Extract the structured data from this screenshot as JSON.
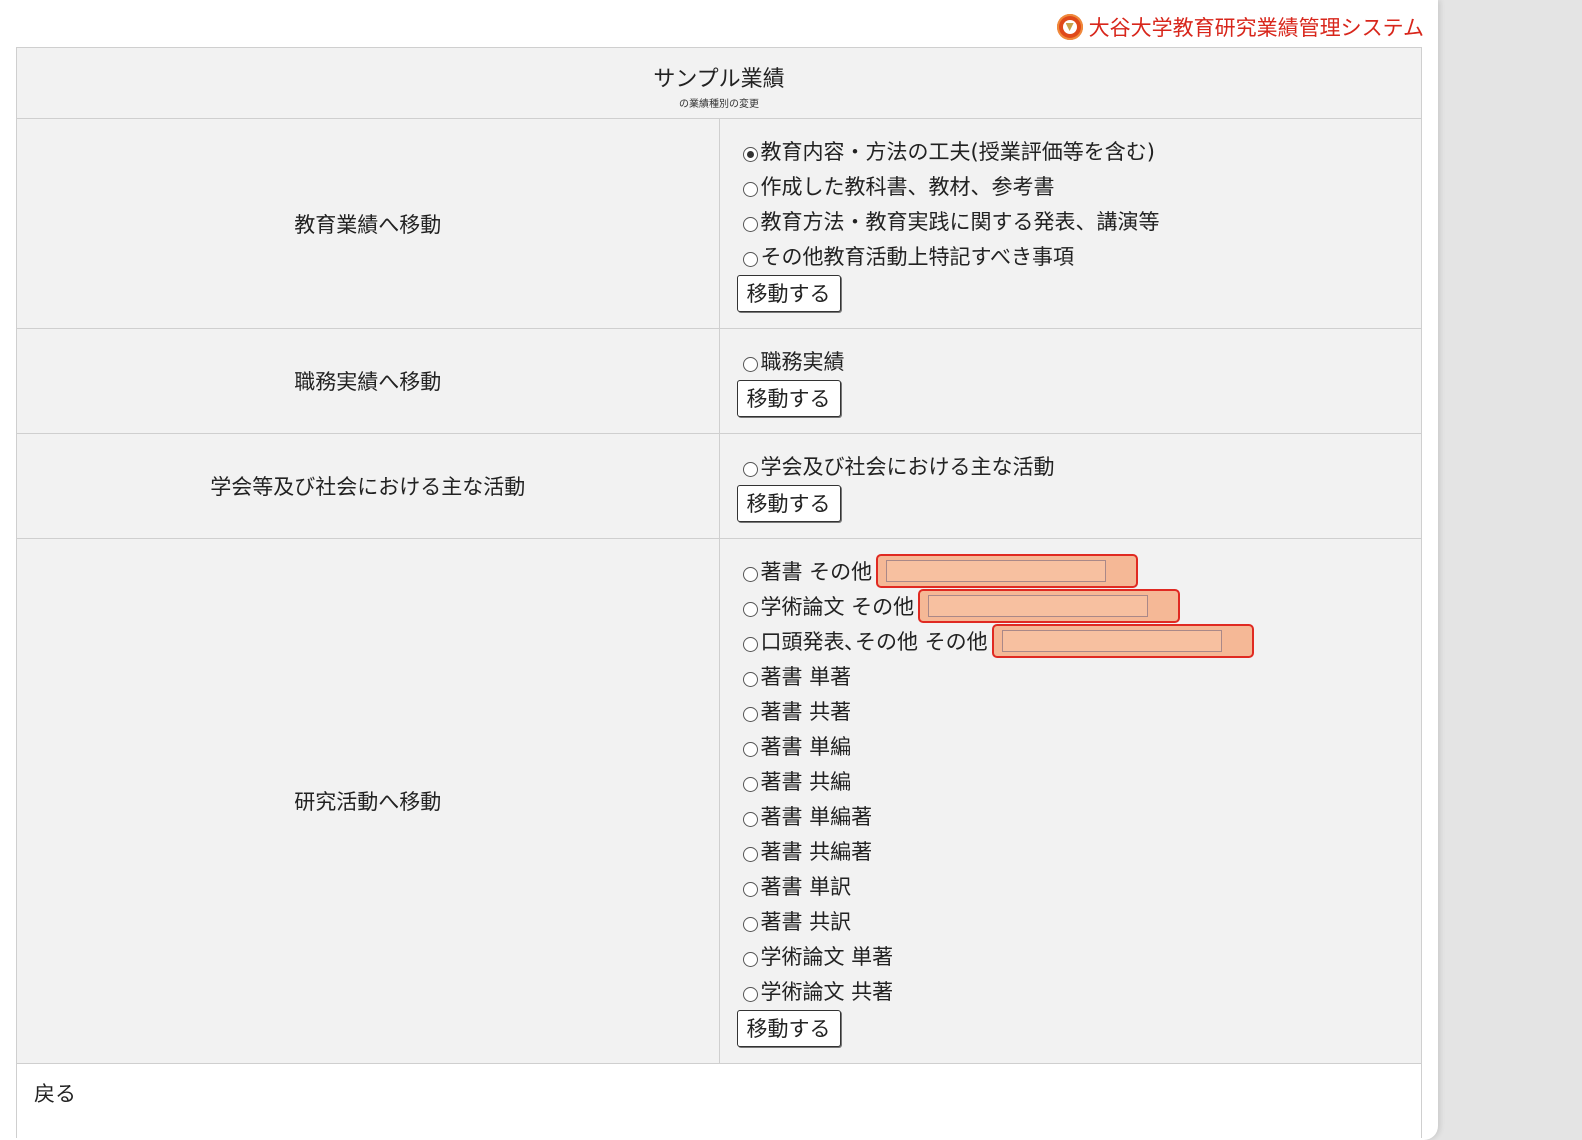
{
  "header": {
    "brand_title": "大谷大学教育研究業績管理システム",
    "logo_icon": "university-logo-icon",
    "brand_color": "#d8261b"
  },
  "card": {
    "title": "サンプル業績",
    "subtitle": "の業績種別の変更"
  },
  "sections": [
    {
      "label": "教育業績へ移動",
      "options": [
        {
          "text": "教育内容・方法の工夫(授業評価等を含む)",
          "checked": true
        },
        {
          "text": "作成した教科書、教材、参考書",
          "checked": false
        },
        {
          "text": "教育方法・教育実践に関する発表、講演等",
          "checked": false
        },
        {
          "text": "その他教育活動上特記すべき事項",
          "checked": false
        }
      ],
      "button": "移動する"
    },
    {
      "label": "職務実績へ移動",
      "options": [
        {
          "text": "職務実績",
          "checked": false
        }
      ],
      "button": "移動する"
    },
    {
      "label": "学会等及び社会における主な活動",
      "options": [
        {
          "text": "学会及び社会における主な活動",
          "checked": false
        }
      ],
      "button": "移動する"
    },
    {
      "label": "研究活動へ移動",
      "options": [
        {
          "text": "著書 その他",
          "checked": false
        },
        {
          "text": "学術論文 その他",
          "checked": false
        },
        {
          "text": "口頭発表､その他 その他",
          "checked": false
        },
        {
          "text": "著書 単著",
          "checked": false
        },
        {
          "text": "著書 共著",
          "checked": false
        },
        {
          "text": "著書 単編",
          "checked": false
        },
        {
          "text": "著書 共編",
          "checked": false
        },
        {
          "text": "著書 単編著",
          "checked": false
        },
        {
          "text": "著書 共編著",
          "checked": false
        },
        {
          "text": "著書 単訳",
          "checked": false
        },
        {
          "text": "著書 共訳",
          "checked": false
        },
        {
          "text": "学術論文 単著",
          "checked": false
        },
        {
          "text": "学術論文 共著",
          "checked": false
        }
      ],
      "button": "移動する"
    }
  ],
  "footer": {
    "back_link": "戻る"
  }
}
